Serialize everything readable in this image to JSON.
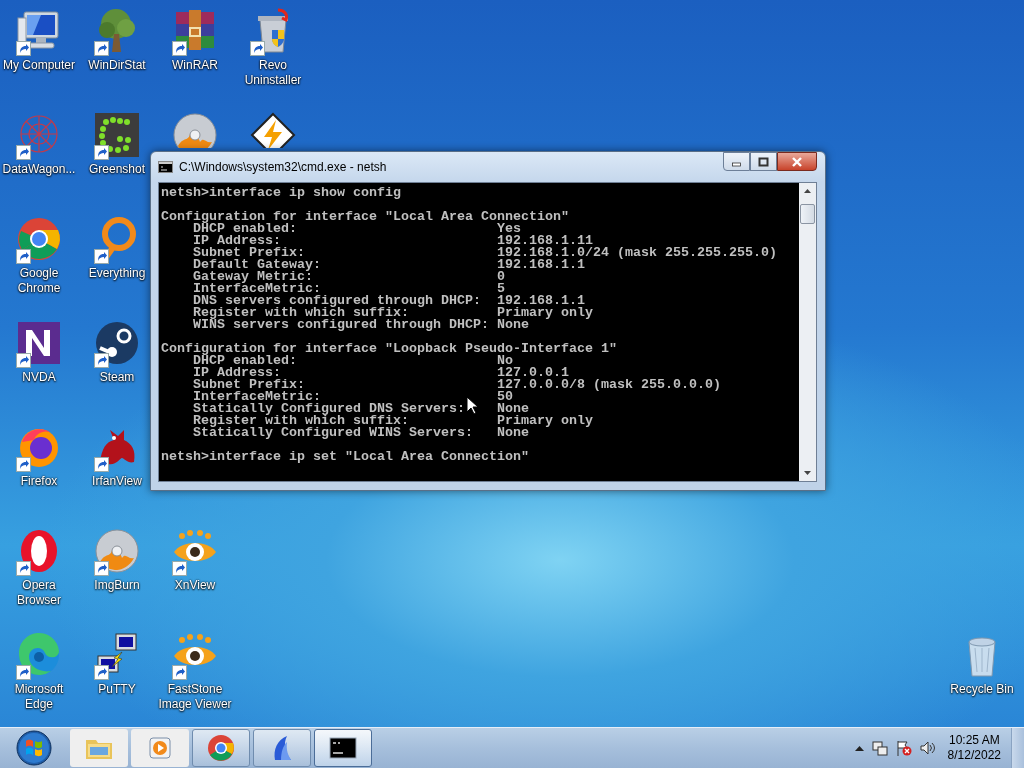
{
  "desktop_columns": [
    [
      {
        "kind": "computer",
        "label": "My Computer"
      },
      {
        "kind": "network",
        "label": "DataWagon..."
      },
      {
        "kind": "wheel",
        "label": "Google Chrome"
      },
      {
        "kind": "nletter",
        "label": "NVDA"
      },
      {
        "kind": "fox",
        "label": "Firefox"
      },
      {
        "kind": "oring",
        "label": "Opera Browser"
      },
      {
        "kind": "wave",
        "label": "Microsoft Edge"
      }
    ],
    [
      {
        "kind": "tree",
        "label": "WinDirStat"
      },
      {
        "kind": "dots",
        "label": "Greenshot"
      },
      {
        "kind": "ring",
        "label": "Everything"
      },
      {
        "kind": "steam",
        "label": "Steam"
      },
      {
        "kind": "cat",
        "label": "IrfanView"
      },
      {
        "kind": "disc",
        "label": "ImgBurn"
      },
      {
        "kind": "terminals",
        "label": "PuTTY"
      }
    ],
    [
      {
        "kind": "archive",
        "label": "WinRAR"
      },
      {
        "kind": "disc"
      },
      {
        "kind": "gap"
      },
      {
        "kind": "gap"
      },
      {
        "kind": "gap"
      },
      {
        "kind": "eye",
        "label": "XnView"
      },
      {
        "kind": "eye",
        "label": "FastStone Image Viewer"
      }
    ],
    [
      {
        "kind": "bin",
        "label": "Revo Uninstaller"
      },
      {
        "kind": "bolt"
      }
    ]
  ],
  "window": {
    "title": "C:\\Windows\\system32\\cmd.exe - netsh",
    "console": [
      {
        "kind": "prompt",
        "text": "netsh>interface ip show config"
      },
      {
        "kind": "config",
        "heading": "Configuration for interface \"Local Area Connection\"",
        "rows": [
          {
            "label": "DHCP enabled:",
            "value": "Yes"
          },
          {
            "label": "IP Address:",
            "value": "192.168.1.11"
          },
          {
            "label": "Subnet Prefix:",
            "value": "192.168.1.0/24 (mask 255.255.255.0)"
          },
          {
            "label": "Default Gateway:",
            "value": "192.168.1.1"
          },
          {
            "label": "Gateway Metric:",
            "value": "0"
          },
          {
            "label": "InterfaceMetric:",
            "value": "5"
          },
          {
            "label": "DNS servers configured through DHCP:",
            "value": "192.168.1.1"
          },
          {
            "label": "Register with which suffix:",
            "value": "Primary only"
          },
          {
            "label": "WINS servers configured through DHCP:",
            "value": "None"
          }
        ]
      },
      {
        "kind": "config",
        "heading": "Configuration for interface \"Loopback Pseudo-Interface 1\"",
        "rows": [
          {
            "label": "DHCP enabled:",
            "value": "No"
          },
          {
            "label": "IP Address:",
            "value": "127.0.0.1"
          },
          {
            "label": "Subnet Prefix:",
            "value": "127.0.0.0/8 (mask 255.0.0.0)"
          },
          {
            "label": "InterfaceMetric:",
            "value": "50"
          },
          {
            "label": "Statically Configured DNS Servers:",
            "value": "None"
          },
          {
            "label": "Register with which suffix:",
            "value": "Primary only"
          },
          {
            "label": "Statically Configured WINS Servers:",
            "value": "None"
          }
        ]
      },
      {
        "kind": "prompt",
        "text": "netsh>interface ip set \"Local Area Connection\""
      }
    ]
  },
  "recycle_bin": {
    "label": "Recycle Bin"
  },
  "taskbar": {
    "items": [
      {
        "kind": "folder",
        "running": false,
        "selected": false
      },
      {
        "kind": "player",
        "running": false,
        "selected": false
      },
      {
        "kind": "wheel",
        "running": true,
        "selected": false
      },
      {
        "kind": "fin",
        "running": true,
        "selected": false
      },
      {
        "kind": "console",
        "running": true,
        "selected": true
      }
    ],
    "clock": {
      "time": "10:25 AM",
      "date": "8/12/2022"
    }
  }
}
